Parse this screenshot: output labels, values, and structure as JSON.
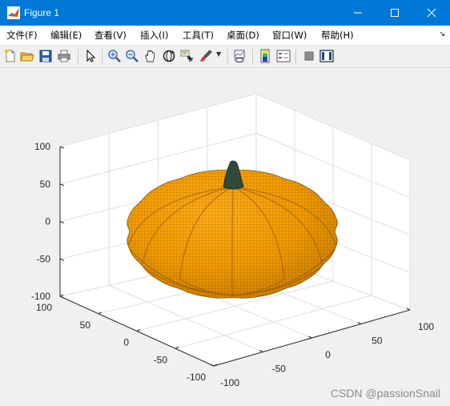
{
  "window": {
    "title": "Figure 1",
    "titlebar_color": "#0078d7"
  },
  "menubar": {
    "items": [
      {
        "label": "文件(F)"
      },
      {
        "label": "编辑(E)"
      },
      {
        "label": "查看(V)"
      },
      {
        "label": "插入(I)"
      },
      {
        "label": "工具(T)"
      },
      {
        "label": "桌面(D)"
      },
      {
        "label": "窗口(W)"
      },
      {
        "label": "帮助(H)"
      }
    ]
  },
  "toolbar": {
    "icons": [
      "new-figure-icon",
      "open-file-icon",
      "save-icon",
      "print-icon",
      "pointer-icon",
      "zoom-in-icon",
      "zoom-out-icon",
      "pan-icon",
      "rotate-3d-icon",
      "data-cursor-icon",
      "brush-icon",
      "link-plot-icon",
      "colorbar-icon",
      "legend-icon",
      "hide-plot-tools-icon",
      "show-plot-tools-icon"
    ]
  },
  "chart_data": {
    "type": "surface-3d",
    "subject": "pumpkin",
    "surface_color": "#f29b00",
    "stem_color": "#2f4a3a",
    "x_ticks": [
      "-100",
      "-50",
      "0",
      "50",
      "100"
    ],
    "y_ticks": [
      "-100",
      "-50",
      "0",
      "50",
      "100"
    ],
    "z_ticks": [
      "-100",
      "-50",
      "0",
      "50",
      "100"
    ],
    "xlim": [
      -100,
      100
    ],
    "ylim": [
      -100,
      100
    ],
    "zlim": [
      -100,
      100
    ],
    "grid": true,
    "box": "open"
  },
  "watermark": "CSDN @passionSnail"
}
